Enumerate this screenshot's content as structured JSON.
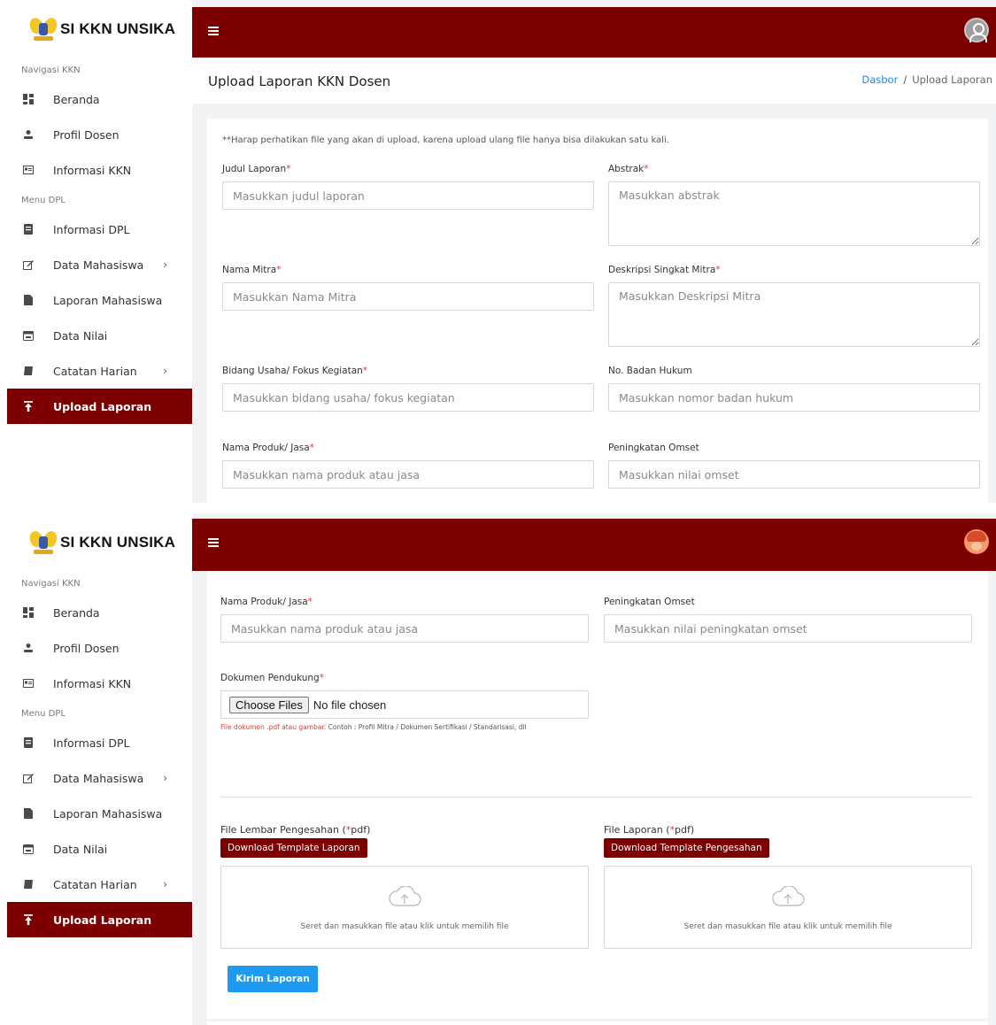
{
  "brand": {
    "name": "SI KKN UNSIKA"
  },
  "sidebar": {
    "section_nav": "Navigasi KKN",
    "section_menu": "Menu DPL",
    "items": [
      {
        "label": "Beranda",
        "icon": "dashboard-icon"
      },
      {
        "label": "Profil Dosen",
        "icon": "user-icon"
      },
      {
        "label": "Informasi KKN",
        "icon": "id-card-icon"
      },
      {
        "label": "Informasi DPL",
        "icon": "document-icon"
      },
      {
        "label": "Data Mahasiswa",
        "icon": "edit-icon"
      },
      {
        "label": "Laporan Mahasiswa",
        "icon": "file-icon"
      },
      {
        "label": "Data Nilai",
        "icon": "calendar-icon"
      },
      {
        "label": "Catatan Harian",
        "icon": "book-icon"
      },
      {
        "label": "Upload Laporan",
        "icon": "upload-icon"
      }
    ],
    "chevron": "›"
  },
  "header": {
    "page_title": "Upload Laporan KKN Dosen",
    "breadcrumb_home": "Dasbor",
    "breadcrumb_sep": "/",
    "breadcrumb_current": "Upload Laporan"
  },
  "form": {
    "notice": "**Harap perhatikan file yang akan di upload, karena upload ulang file hanya bisa dilakukan satu kali.",
    "req_mark": "*",
    "judul": {
      "label": "Judul Laporan",
      "placeholder": "Masukkan judul laporan"
    },
    "abstrak": {
      "label": "Abstrak",
      "placeholder": "Masukkan abstrak"
    },
    "mitra": {
      "label": "Nama Mitra",
      "placeholder": "Masukkan Nama Mitra"
    },
    "deskripsi": {
      "label": "Deskripsi Singkat Mitra",
      "placeholder": "Masukkan Deskripsi Mitra"
    },
    "bidang": {
      "label": "Bidang Usaha/ Fokus Kegiatan",
      "placeholder": "Masukkan bidang usaha/ fokus kegiatan"
    },
    "badan_hukum": {
      "label": "No. Badan Hukum",
      "placeholder": "Masukkan nomor badan hukum"
    },
    "produk": {
      "label": "Nama Produk/ Jasa",
      "placeholder": "Masukkan nama produk atau jasa"
    },
    "omset": {
      "label": "Peningkatan Omset",
      "placeholder": "Masukkan nilai omset"
    },
    "omset2": {
      "placeholder": "Masukkan nilai peningkatan omset"
    },
    "dokumen": {
      "label": "Dokumen Pendukung",
      "button": "Choose Files",
      "file_status": "No file chosen",
      "hint_red": "File dokumen .pdf atau gambar.",
      "hint_rest": " Contoh : Profil Mitra / Dokumen Sertifikasi / Standarisasi, dll"
    },
    "pengesahan": {
      "label_pre": "File Lembar Pengesahan (",
      "label_post": "pdf)",
      "download": "Download Template Laporan",
      "drop_text": "Seret dan masukkan file atau klik untuk memilih file"
    },
    "laporan": {
      "label_pre": "File Laporan (",
      "label_post": "pdf)",
      "download": "Download Template Pengesahan",
      "drop_text": "Seret dan masukkan file atau klik untuk memilih file"
    },
    "submit": "Kirim Laporan"
  },
  "colors": {
    "primary": "#7c0000",
    "accent_blue": "#1e9bf0",
    "required": "#e53935",
    "link": "#1e88e5"
  }
}
